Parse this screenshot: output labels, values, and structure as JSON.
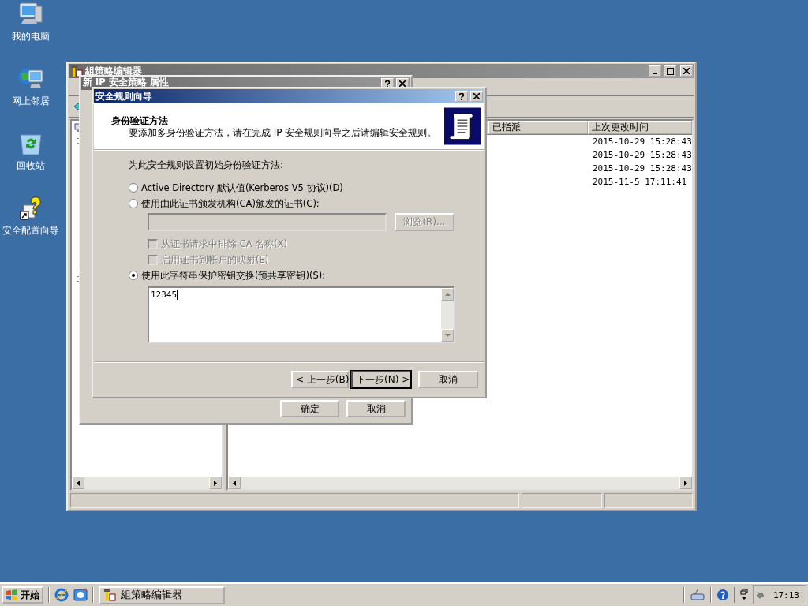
{
  "desktop_icons": [
    {
      "label": "我的电脑",
      "kind": "computer"
    },
    {
      "label": "网上邻居",
      "kind": "network"
    },
    {
      "label": "回收站",
      "kind": "recycle"
    },
    {
      "label": "安全配置向导",
      "kind": "wizard"
    }
  ],
  "main_window": {
    "title": "組策略编辑器",
    "columns": [
      "已指派",
      "上次更改时间"
    ],
    "rows": [
      {
        "last_changed": "2015-10-29 15:28:43"
      },
      {
        "last_changed": "2015-10-29 15:28:43"
      },
      {
        "last_changed": "2015-10-29 15:28:43"
      },
      {
        "last_changed": "2015-11-5 17:11:41"
      }
    ]
  },
  "properties_dialog": {
    "title": "新 IP 安全策略 属性",
    "buttons": [
      "确定",
      "取消"
    ]
  },
  "wizard": {
    "title": "安全规则向导",
    "header_title": "身份验证方法",
    "header_text": "要添加多身份验证方法，请在完成 IP 安全规则向导之后请编辑安全规则。",
    "prompt": "为此安全规则设置初始身份验证方法:",
    "options": [
      {
        "kind": "radio",
        "label": "Active Directory 默认值(Kerberos V5 协议)(D)",
        "selected": false
      },
      {
        "kind": "radio",
        "label": "使用由此证书颁发机构(CA)颁发的证书(C):",
        "selected": false
      },
      {
        "kind": "cert_field",
        "disabled": true
      },
      {
        "kind": "checkbox",
        "label": "从证书请求中排除 CA 名称(X)",
        "checked": false,
        "disabled": true
      },
      {
        "kind": "checkbox",
        "label": "启用证书到帐户的映射(E)",
        "checked": false,
        "disabled": true
      },
      {
        "kind": "radio",
        "label": "使用此字符串保护密钥交换(预共享密钥)(S):",
        "selected": true
      },
      {
        "kind": "key_field",
        "value": "12345"
      }
    ],
    "browse_button": {
      "label": "浏览(R)...",
      "disabled": true
    },
    "buttons": [
      "< 上一步(B)",
      "下一步(N) >",
      "取消"
    ]
  },
  "taskbar": {
    "start": "开始",
    "task": "組策略编辑器",
    "clock": "17:13"
  }
}
